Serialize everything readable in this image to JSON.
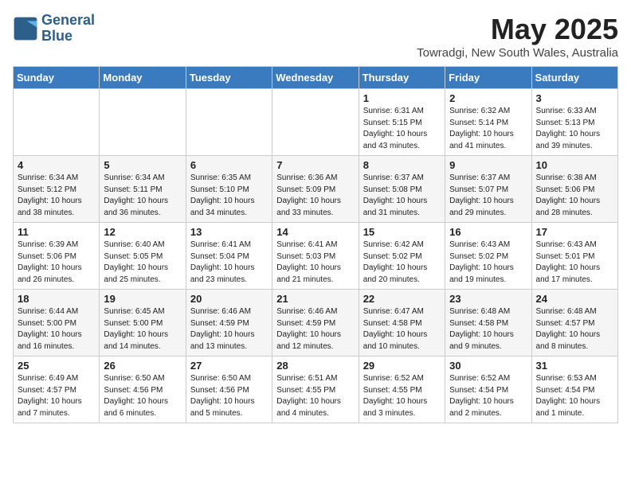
{
  "header": {
    "logo_line1": "General",
    "logo_line2": "Blue",
    "month_title": "May 2025",
    "location": "Towradgi, New South Wales, Australia"
  },
  "weekdays": [
    "Sunday",
    "Monday",
    "Tuesday",
    "Wednesday",
    "Thursday",
    "Friday",
    "Saturday"
  ],
  "weeks": [
    [
      {
        "day": "",
        "info": ""
      },
      {
        "day": "",
        "info": ""
      },
      {
        "day": "",
        "info": ""
      },
      {
        "day": "",
        "info": ""
      },
      {
        "day": "1",
        "info": "Sunrise: 6:31 AM\nSunset: 5:15 PM\nDaylight: 10 hours\nand 43 minutes."
      },
      {
        "day": "2",
        "info": "Sunrise: 6:32 AM\nSunset: 5:14 PM\nDaylight: 10 hours\nand 41 minutes."
      },
      {
        "day": "3",
        "info": "Sunrise: 6:33 AM\nSunset: 5:13 PM\nDaylight: 10 hours\nand 39 minutes."
      }
    ],
    [
      {
        "day": "4",
        "info": "Sunrise: 6:34 AM\nSunset: 5:12 PM\nDaylight: 10 hours\nand 38 minutes."
      },
      {
        "day": "5",
        "info": "Sunrise: 6:34 AM\nSunset: 5:11 PM\nDaylight: 10 hours\nand 36 minutes."
      },
      {
        "day": "6",
        "info": "Sunrise: 6:35 AM\nSunset: 5:10 PM\nDaylight: 10 hours\nand 34 minutes."
      },
      {
        "day": "7",
        "info": "Sunrise: 6:36 AM\nSunset: 5:09 PM\nDaylight: 10 hours\nand 33 minutes."
      },
      {
        "day": "8",
        "info": "Sunrise: 6:37 AM\nSunset: 5:08 PM\nDaylight: 10 hours\nand 31 minutes."
      },
      {
        "day": "9",
        "info": "Sunrise: 6:37 AM\nSunset: 5:07 PM\nDaylight: 10 hours\nand 29 minutes."
      },
      {
        "day": "10",
        "info": "Sunrise: 6:38 AM\nSunset: 5:06 PM\nDaylight: 10 hours\nand 28 minutes."
      }
    ],
    [
      {
        "day": "11",
        "info": "Sunrise: 6:39 AM\nSunset: 5:06 PM\nDaylight: 10 hours\nand 26 minutes."
      },
      {
        "day": "12",
        "info": "Sunrise: 6:40 AM\nSunset: 5:05 PM\nDaylight: 10 hours\nand 25 minutes."
      },
      {
        "day": "13",
        "info": "Sunrise: 6:41 AM\nSunset: 5:04 PM\nDaylight: 10 hours\nand 23 minutes."
      },
      {
        "day": "14",
        "info": "Sunrise: 6:41 AM\nSunset: 5:03 PM\nDaylight: 10 hours\nand 21 minutes."
      },
      {
        "day": "15",
        "info": "Sunrise: 6:42 AM\nSunset: 5:02 PM\nDaylight: 10 hours\nand 20 minutes."
      },
      {
        "day": "16",
        "info": "Sunrise: 6:43 AM\nSunset: 5:02 PM\nDaylight: 10 hours\nand 19 minutes."
      },
      {
        "day": "17",
        "info": "Sunrise: 6:43 AM\nSunset: 5:01 PM\nDaylight: 10 hours\nand 17 minutes."
      }
    ],
    [
      {
        "day": "18",
        "info": "Sunrise: 6:44 AM\nSunset: 5:00 PM\nDaylight: 10 hours\nand 16 minutes."
      },
      {
        "day": "19",
        "info": "Sunrise: 6:45 AM\nSunset: 5:00 PM\nDaylight: 10 hours\nand 14 minutes."
      },
      {
        "day": "20",
        "info": "Sunrise: 6:46 AM\nSunset: 4:59 PM\nDaylight: 10 hours\nand 13 minutes."
      },
      {
        "day": "21",
        "info": "Sunrise: 6:46 AM\nSunset: 4:59 PM\nDaylight: 10 hours\nand 12 minutes."
      },
      {
        "day": "22",
        "info": "Sunrise: 6:47 AM\nSunset: 4:58 PM\nDaylight: 10 hours\nand 10 minutes."
      },
      {
        "day": "23",
        "info": "Sunrise: 6:48 AM\nSunset: 4:58 PM\nDaylight: 10 hours\nand 9 minutes."
      },
      {
        "day": "24",
        "info": "Sunrise: 6:48 AM\nSunset: 4:57 PM\nDaylight: 10 hours\nand 8 minutes."
      }
    ],
    [
      {
        "day": "25",
        "info": "Sunrise: 6:49 AM\nSunset: 4:57 PM\nDaylight: 10 hours\nand 7 minutes."
      },
      {
        "day": "26",
        "info": "Sunrise: 6:50 AM\nSunset: 4:56 PM\nDaylight: 10 hours\nand 6 minutes."
      },
      {
        "day": "27",
        "info": "Sunrise: 6:50 AM\nSunset: 4:56 PM\nDaylight: 10 hours\nand 5 minutes."
      },
      {
        "day": "28",
        "info": "Sunrise: 6:51 AM\nSunset: 4:55 PM\nDaylight: 10 hours\nand 4 minutes."
      },
      {
        "day": "29",
        "info": "Sunrise: 6:52 AM\nSunset: 4:55 PM\nDaylight: 10 hours\nand 3 minutes."
      },
      {
        "day": "30",
        "info": "Sunrise: 6:52 AM\nSunset: 4:54 PM\nDaylight: 10 hours\nand 2 minutes."
      },
      {
        "day": "31",
        "info": "Sunrise: 6:53 AM\nSunset: 4:54 PM\nDaylight: 10 hours\nand 1 minute."
      }
    ]
  ]
}
